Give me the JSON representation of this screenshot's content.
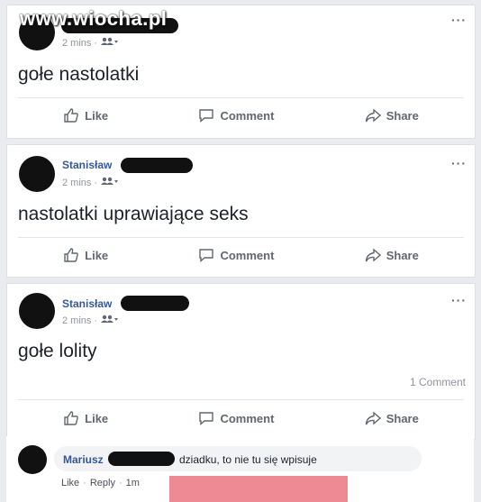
{
  "watermark": "www.wiocha.pl",
  "colors": {
    "accent": "#365899",
    "background": "#e9ebee",
    "redaction": "#111111",
    "overlay": "#ee8a94"
  },
  "posts": [
    {
      "author": "",
      "time": "2 mins",
      "separator": "·",
      "audience_icon": "friends-icon",
      "text": "gołe nastolatki",
      "more": "···",
      "actions": {
        "like": "Like",
        "comment": "Comment",
        "share": "Share"
      }
    },
    {
      "author": "Stanisław",
      "time": "2 mins",
      "separator": "·",
      "audience_icon": "friends-icon",
      "text": "nastolatki uprawiające seks",
      "more": "···",
      "actions": {
        "like": "Like",
        "comment": "Comment",
        "share": "Share"
      }
    },
    {
      "author": "Stanisław",
      "time": "2 mins",
      "separator": "·",
      "audience_icon": "friends-icon",
      "text": "gołe lolity",
      "more": "···",
      "comment_count": "1 Comment",
      "actions": {
        "like": "Like",
        "comment": "Comment",
        "share": "Share"
      }
    }
  ],
  "comment": {
    "author": "Mariusz",
    "text": "dziadku, to nie tu się wpisuje",
    "like": "Like",
    "reply": "Reply",
    "dot": "·",
    "time": "1m"
  }
}
